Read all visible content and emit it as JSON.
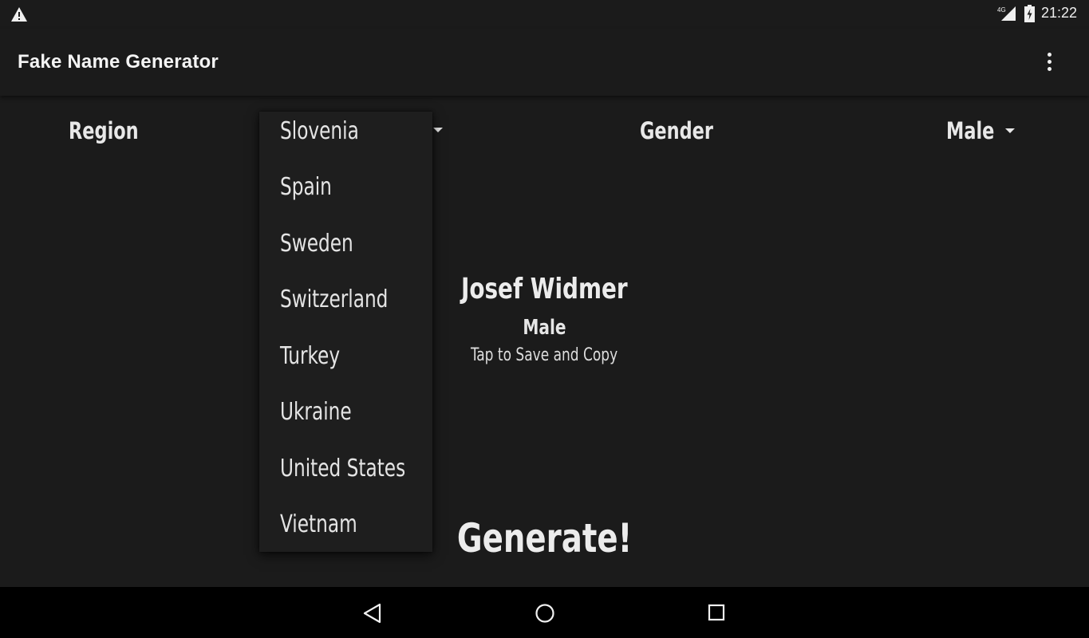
{
  "status_bar": {
    "time": "21:22",
    "network": "4G",
    "alert_icon": "warning-icon",
    "signal_icon": "cell-signal-icon",
    "battery_icon": "battery-charging-icon"
  },
  "app_bar": {
    "title": "Fake Name Generator",
    "menu_icon": "overflow-menu-icon"
  },
  "filters": {
    "region_label": "Region",
    "region_selected": "Slovenia",
    "gender_label": "Gender",
    "gender_selected": "Male"
  },
  "region_dropdown": {
    "items": [
      "Slovenia",
      "Spain",
      "Sweden",
      "Switzerland",
      "Turkey",
      "Ukraine",
      "United States",
      "Vietnam"
    ]
  },
  "result": {
    "name": "Josef Widmer",
    "gender": "Male",
    "hint": "Tap to Save and Copy"
  },
  "actions": {
    "generate_label": "Generate!"
  },
  "colors": {
    "background": "#1b1b1b",
    "text": "#e8e8e8",
    "nav_bar": "#000000"
  }
}
